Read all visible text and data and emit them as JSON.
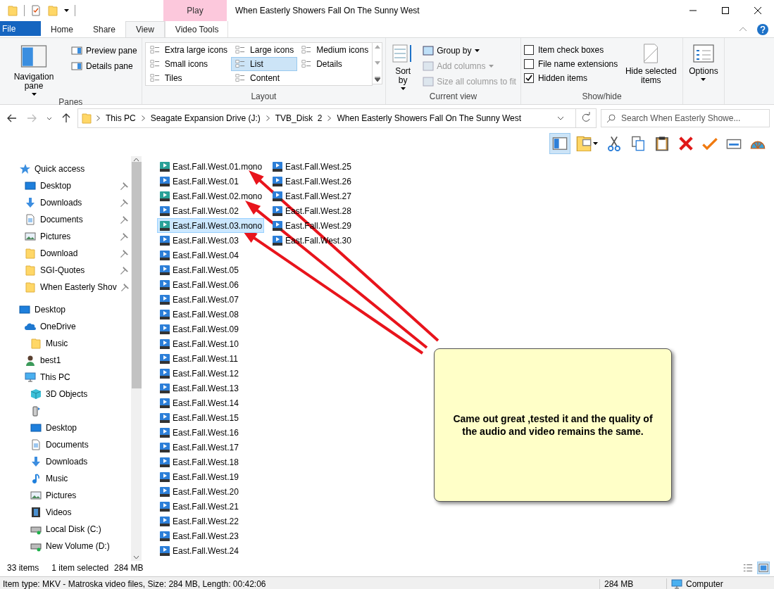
{
  "title_bar": {
    "title": "When Easterly Showers Fall On The Sunny West",
    "context_header": "Play"
  },
  "ribbon_tabs": [
    {
      "label": "File",
      "kind": "file",
      "selected": false
    },
    {
      "label": "Home",
      "kind": "tab",
      "selected": false
    },
    {
      "label": "Share",
      "kind": "tab",
      "selected": false
    },
    {
      "label": "View",
      "kind": "tab",
      "selected": true
    },
    {
      "label": "Video Tools",
      "kind": "context",
      "selected": false
    }
  ],
  "ribbon": {
    "panes": {
      "label": "Panes",
      "navigation_pane": "Navigation pane",
      "items": [
        "Preview pane",
        "Details pane"
      ]
    },
    "layout": {
      "label": "Layout",
      "options": [
        {
          "label": "Extra large icons",
          "selected": false
        },
        {
          "label": "Large icons",
          "selected": false
        },
        {
          "label": "Medium icons",
          "selected": false
        },
        {
          "label": "Small icons",
          "selected": false
        },
        {
          "label": "List",
          "selected": true
        },
        {
          "label": "Details",
          "selected": false
        },
        {
          "label": "Tiles",
          "selected": false
        },
        {
          "label": "Content",
          "selected": false
        }
      ]
    },
    "current_view": {
      "label": "Current view",
      "sort_by": "Sort by",
      "items": [
        {
          "label": "Group by",
          "disabled": false,
          "dropdown": true
        },
        {
          "label": "Add columns",
          "disabled": true,
          "dropdown": true
        },
        {
          "label": "Size all columns to fit",
          "disabled": true,
          "dropdown": false
        }
      ]
    },
    "show_hide": {
      "label": "Show/hide",
      "checkboxes": [
        {
          "label": "Item check boxes",
          "checked": false
        },
        {
          "label": "File name extensions",
          "checked": false
        },
        {
          "label": "Hidden items",
          "checked": true
        }
      ],
      "hide_selected": "Hide selected items"
    },
    "options": "Options"
  },
  "address": {
    "path": [
      "This PC",
      "Seagate Expansion Drive (J:)",
      "TVB_Disk  2",
      "When Easterly Showers Fall On The Sunny West"
    ],
    "search_placeholder": "Search When Easterly Showe..."
  },
  "toolbar": [
    {
      "kind": "pane",
      "selected": true
    },
    {
      "kind": "properties",
      "selected": false
    },
    {
      "kind": "cut",
      "selected": false
    },
    {
      "kind": "copy",
      "selected": false
    },
    {
      "kind": "paste",
      "selected": false
    },
    {
      "kind": "delete",
      "selected": false
    },
    {
      "kind": "check",
      "selected": false
    },
    {
      "kind": "card",
      "selected": false
    },
    {
      "kind": "shell",
      "selected": false
    }
  ],
  "sidebar": [
    {
      "label": "Quick access",
      "kind": "star",
      "children": [
        {
          "label": "Desktop",
          "kind": "desktop",
          "pinned": true
        },
        {
          "label": "Downloads",
          "kind": "download",
          "pinned": true
        },
        {
          "label": "Documents",
          "kind": "document",
          "pinned": true
        },
        {
          "label": "Pictures",
          "kind": "picture",
          "pinned": true
        },
        {
          "label": "Download",
          "kind": "folder",
          "pinned": true
        },
        {
          "label": "SGI-Quotes",
          "kind": "folder",
          "pinned": true
        },
        {
          "label": "When Easterly Shov",
          "kind": "folder",
          "pinned": true
        }
      ]
    },
    {
      "label": "Desktop",
      "kind": "desktop",
      "children": [
        {
          "label": "OneDrive",
          "kind": "cloud",
          "children": [
            {
              "label": "Music",
              "kind": "folder"
            }
          ]
        },
        {
          "label": "best1",
          "kind": "user"
        },
        {
          "label": "This PC",
          "kind": "pc",
          "children": [
            {
              "label": "3D Objects",
              "kind": "cube"
            },
            {
              "kind": "device"
            },
            {
              "label": "Desktop",
              "kind": "desktop"
            },
            {
              "label": "Documents",
              "kind": "document"
            },
            {
              "label": "Downloads",
              "kind": "download"
            },
            {
              "label": "Music",
              "kind": "music"
            },
            {
              "label": "Pictures",
              "kind": "picture"
            },
            {
              "label": "Videos",
              "kind": "video"
            },
            {
              "label": "Local Disk (C:)",
              "kind": "disk"
            },
            {
              "label": "New Volume (D:)",
              "kind": "disk"
            }
          ]
        }
      ]
    }
  ],
  "files": [
    [
      {
        "name": "East.Fall.West.01.mono",
        "kind": "mkv",
        "selected": false
      },
      {
        "name": "East.Fall.West.01",
        "kind": "rmvb",
        "selected": false
      },
      {
        "name": "East.Fall.West.02.mono",
        "kind": "mkv",
        "selected": false
      },
      {
        "name": "East.Fall.West.02",
        "kind": "rmvb",
        "selected": false
      },
      {
        "name": "East.Fall.West.03.mono",
        "kind": "mkv",
        "selected": true
      },
      {
        "name": "East.Fall.West.03",
        "kind": "rmvb",
        "selected": false
      },
      {
        "name": "East.Fall.West.04",
        "kind": "rmvb",
        "selected": false
      },
      {
        "name": "East.Fall.West.05",
        "kind": "rmvb",
        "selected": false
      },
      {
        "name": "East.Fall.West.06",
        "kind": "rmvb",
        "selected": false
      },
      {
        "name": "East.Fall.West.07",
        "kind": "rmvb",
        "selected": false
      },
      {
        "name": "East.Fall.West.08",
        "kind": "rmvb",
        "selected": false
      },
      {
        "name": "East.Fall.West.09",
        "kind": "rmvb",
        "selected": false
      },
      {
        "name": "East.Fall.West.10",
        "kind": "rmvb",
        "selected": false
      },
      {
        "name": "East.Fall.West.11",
        "kind": "rmvb",
        "selected": false
      },
      {
        "name": "East.Fall.West.12",
        "kind": "rmvb",
        "selected": false
      },
      {
        "name": "East.Fall.West.13",
        "kind": "rmvb",
        "selected": false
      },
      {
        "name": "East.Fall.West.14",
        "kind": "rmvb",
        "selected": false
      },
      {
        "name": "East.Fall.West.15",
        "kind": "rmvb",
        "selected": false
      },
      {
        "name": "East.Fall.West.16",
        "kind": "rmvb",
        "selected": false
      },
      {
        "name": "East.Fall.West.17",
        "kind": "rmvb",
        "selected": false
      },
      {
        "name": "East.Fall.West.18",
        "kind": "rmvb",
        "selected": false
      },
      {
        "name": "East.Fall.West.19",
        "kind": "rmvb",
        "selected": false
      },
      {
        "name": "East.Fall.West.20",
        "kind": "rmvb",
        "selected": false
      },
      {
        "name": "East.Fall.West.21",
        "kind": "rmvb",
        "selected": false
      },
      {
        "name": "East.Fall.West.22",
        "kind": "rmvb",
        "selected": false
      },
      {
        "name": "East.Fall.West.23",
        "kind": "rmvb",
        "selected": false
      },
      {
        "name": "East.Fall.West.24",
        "kind": "rmvb",
        "selected": false
      }
    ],
    [
      {
        "name": "East.Fall.West.25",
        "kind": "rmvb",
        "selected": false
      },
      {
        "name": "East.Fall.West.26",
        "kind": "rmvb",
        "selected": false
      },
      {
        "name": "East.Fall.West.27",
        "kind": "rmvb",
        "selected": false
      },
      {
        "name": "East.Fall.West.28",
        "kind": "rmvb",
        "selected": false
      },
      {
        "name": "East.Fall.West.29",
        "kind": "rmvb",
        "selected": false
      },
      {
        "name": "East.Fall.West.30",
        "kind": "rmvb",
        "selected": false
      }
    ]
  ],
  "note": {
    "text": "Came out great ,tested it and the quality of the audio and video remains the same."
  },
  "status_bar": {
    "count": "33 items",
    "selection": "1 item selected",
    "selection_size": "284 MB"
  },
  "details_bar": {
    "info": "Item type: MKV - Matroska video files, Size: 284 MB, Length: 00:42:06",
    "size": "284 MB",
    "location": "Computer"
  }
}
